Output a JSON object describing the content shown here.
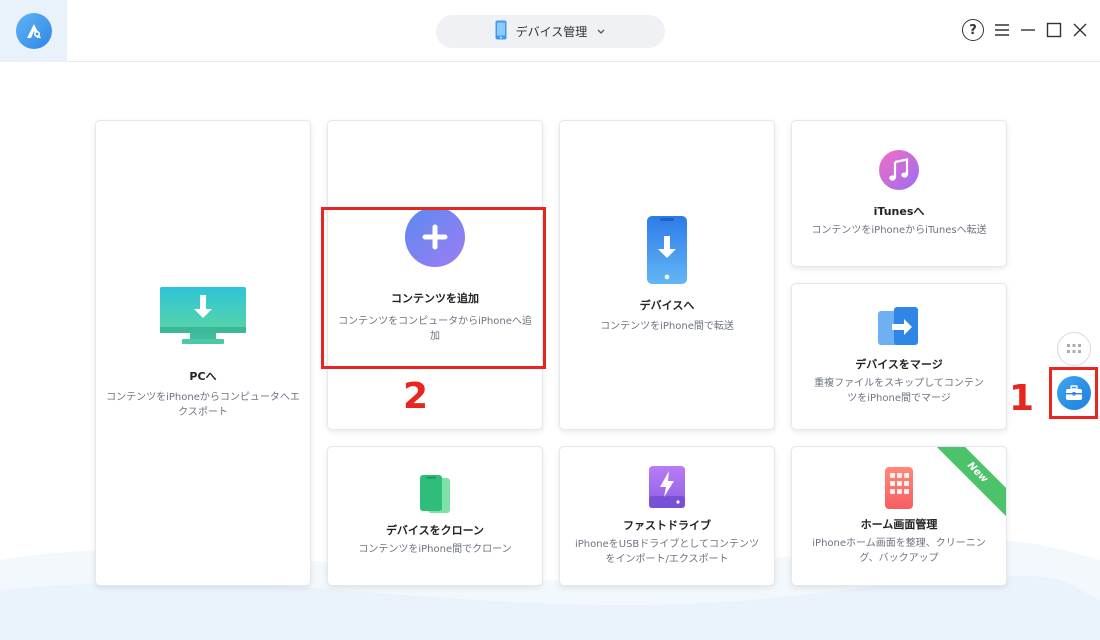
{
  "header": {
    "device_selector": "デバイス管理"
  },
  "cards": {
    "to_pc": {
      "title": "PCへ",
      "desc": "コンテンツをiPhoneからコンピュータへエクスポート"
    },
    "add_content": {
      "title": "コンテンツを追加",
      "desc": "コンテンツをコンピュータからiPhoneへ追加"
    },
    "to_device": {
      "title": "デバイスへ",
      "desc": "コンテンツをiPhone間で転送"
    },
    "to_itunes": {
      "title": "iTunesへ",
      "desc": "コンテンツをiPhoneからiTunesへ転送"
    },
    "merge_device": {
      "title": "デバイスをマージ",
      "desc": "重複ファイルをスキップしてコンテンツをiPhone間でマージ"
    },
    "clone_device": {
      "title": "デバイスをクローン",
      "desc": "コンテンツをiPhone間でクローン"
    },
    "fast_drive": {
      "title": "ファストドライブ",
      "desc": "iPhoneをUSBドライブとしてコンテンツをインポート/エクスポート"
    },
    "home_screen": {
      "title": "ホーム画面管理",
      "desc": "iPhoneホーム画面を整理、クリーニング、バックアップ",
      "badge": "New"
    }
  },
  "annotations": {
    "step1": "1",
    "step2": "2"
  },
  "colors": {
    "accent_blue": "#2f86e6",
    "highlight_red": "#e8261f",
    "badge_green": "#4cc36a"
  },
  "icons": {
    "logo": "anytrans-logo-icon",
    "device": "phone-icon",
    "chevron": "chevron-down-icon",
    "help": "help-icon",
    "menu": "menu-icon",
    "minimize": "minimize-icon",
    "maximize": "maximize-icon",
    "close": "close-icon",
    "grid": "grid-icon",
    "toolbox": "toolbox-icon"
  }
}
